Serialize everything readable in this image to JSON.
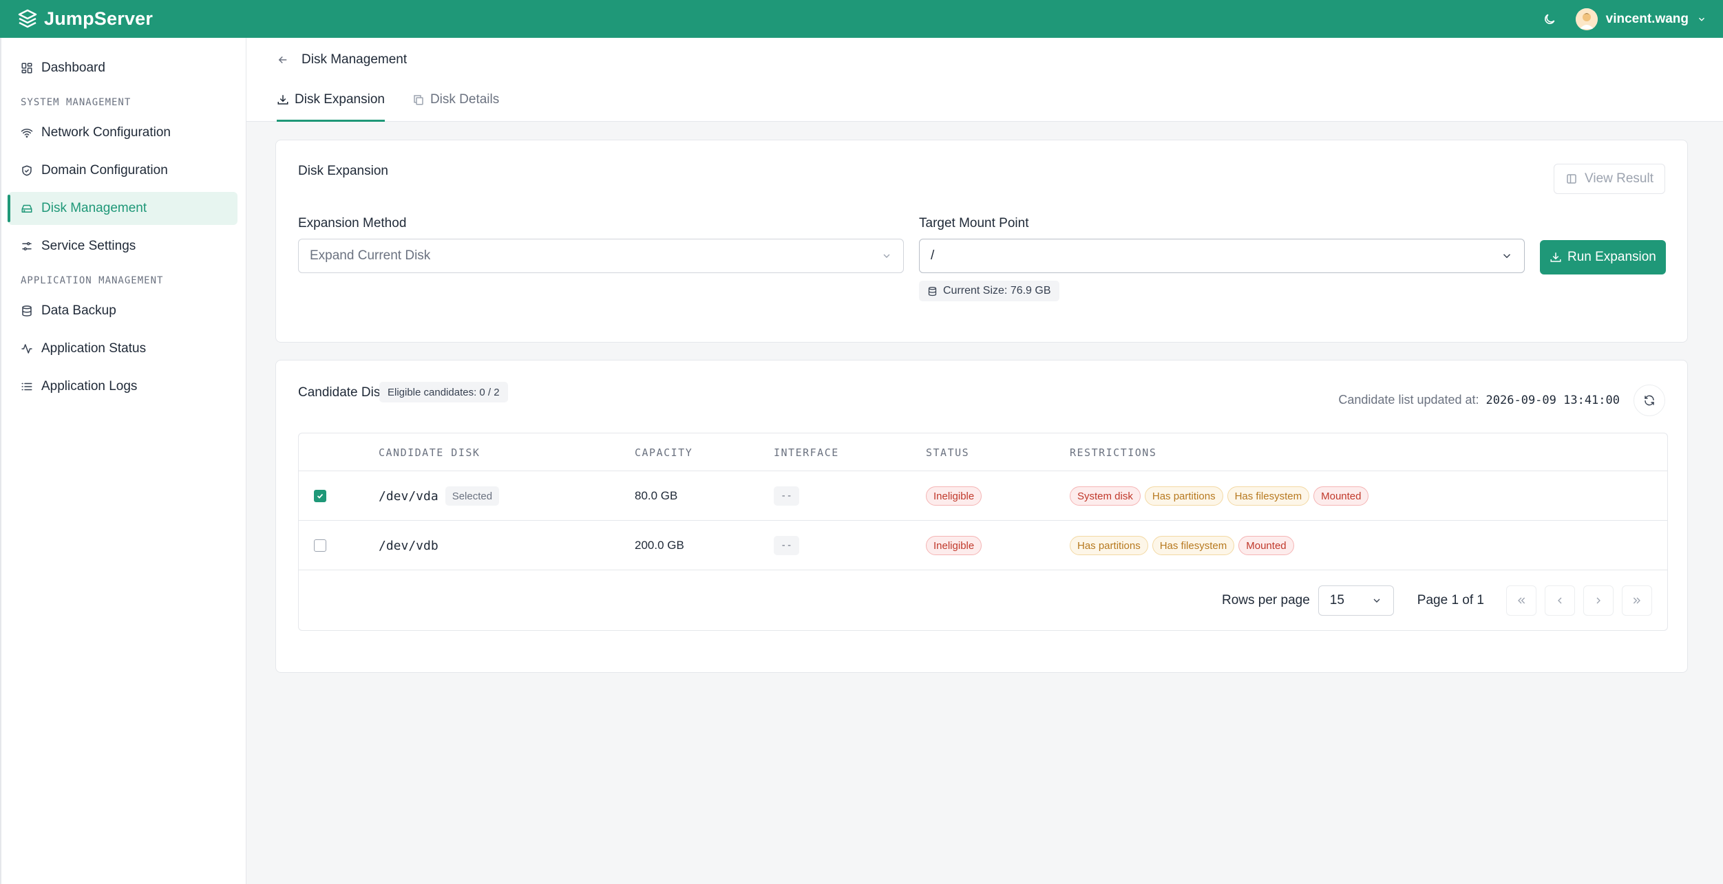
{
  "app": {
    "name": "JumpServer"
  },
  "header": {
    "username": "vincent.wang"
  },
  "sidebar": {
    "top_items": [
      {
        "label": "Dashboard"
      }
    ],
    "sections": [
      {
        "title": "SYSTEM MANAGEMENT",
        "items": [
          {
            "label": "Network Configuration"
          },
          {
            "label": "Domain Configuration"
          },
          {
            "label": "Disk Management",
            "active": true
          },
          {
            "label": "Service Settings"
          }
        ]
      },
      {
        "title": "APPLICATION MANAGEMENT",
        "items": [
          {
            "label": "Data Backup"
          },
          {
            "label": "Application Status"
          },
          {
            "label": "Application Logs"
          }
        ]
      }
    ]
  },
  "page": {
    "title": "Disk Management",
    "tabs": [
      {
        "label": "Disk Expansion",
        "active": true
      },
      {
        "label": "Disk Details"
      }
    ]
  },
  "expansion": {
    "title": "Disk Expansion",
    "view_result_label": "View Result",
    "method_label": "Expansion Method",
    "method_value": "Expand Current Disk",
    "mount_label": "Target Mount Point",
    "mount_value": "/",
    "current_size": "Current Size: 76.9 GB",
    "run_label": "Run Expansion"
  },
  "candidates": {
    "title": "Candidate Disk",
    "eligible": "Eligible candidates: 0 / 2",
    "updated_label": "Candidate list updated at:",
    "updated_at": "2026-09-09 13:41:00",
    "columns": [
      "CANDIDATE DISK",
      "CAPACITY",
      "INTERFACE",
      "STATUS",
      "RESTRICTIONS"
    ],
    "rows": [
      {
        "checked": true,
        "disk": "/dev/vda",
        "badge": "Selected",
        "capacity": "80.0 GB",
        "interface": "--",
        "status": "Ineligible",
        "restrictions": [
          {
            "label": "System disk",
            "tone": "red"
          },
          {
            "label": "Has partitions",
            "tone": "amber"
          },
          {
            "label": "Has filesystem",
            "tone": "amber"
          },
          {
            "label": "Mounted",
            "tone": "red"
          }
        ]
      },
      {
        "checked": false,
        "disk": "/dev/vdb",
        "badge": "",
        "capacity": "200.0 GB",
        "interface": "--",
        "status": "Ineligible",
        "restrictions": [
          {
            "label": "Has partitions",
            "tone": "amber"
          },
          {
            "label": "Has filesystem",
            "tone": "amber"
          },
          {
            "label": "Mounted",
            "tone": "red"
          }
        ]
      }
    ],
    "rows_per_page_label": "Rows per page",
    "rows_per_page": "15",
    "page_info": "Page 1 of 1"
  },
  "colors": {
    "brand": "#1f9878",
    "danger": "#c0392b",
    "warning": "#b7791f"
  }
}
